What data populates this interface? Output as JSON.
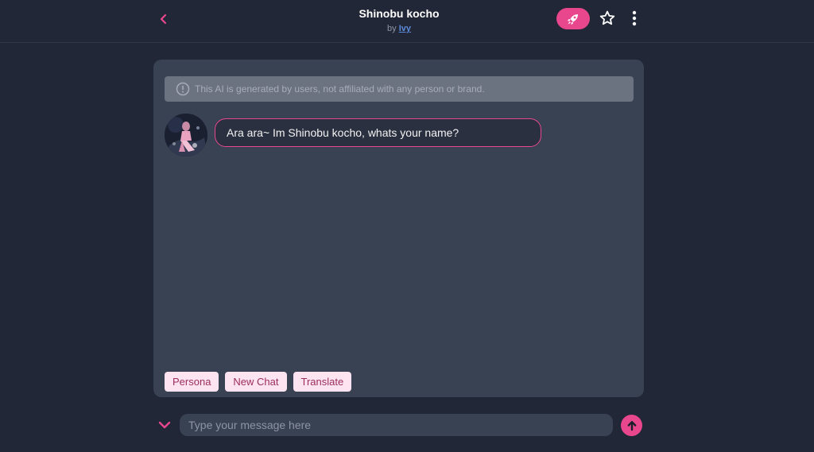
{
  "header": {
    "title": "Shinobu kocho",
    "by_prefix": "by",
    "author": "Ivy",
    "icons": {
      "back": "chevron-left-icon",
      "boost": "rocket-icon",
      "favorite": "star-icon",
      "more": "more-vertical-icon"
    }
  },
  "chat": {
    "disclaimer": "This AI is generated by users, not affiliated with any person or brand.",
    "messages": [
      {
        "sender": "bot",
        "text": "Ara ara~ Im Shinobu kocho, whats your name?"
      }
    ],
    "actions": [
      {
        "label": "Persona"
      },
      {
        "label": "New Chat"
      },
      {
        "label": "Translate"
      }
    ]
  },
  "composer": {
    "placeholder": "Type your message here",
    "value": ""
  },
  "colors": {
    "accent": "#e8478e",
    "background": "#212736",
    "panel": "#394253",
    "chip_bg": "#fde4f0",
    "chip_text": "#9b2d5f"
  }
}
